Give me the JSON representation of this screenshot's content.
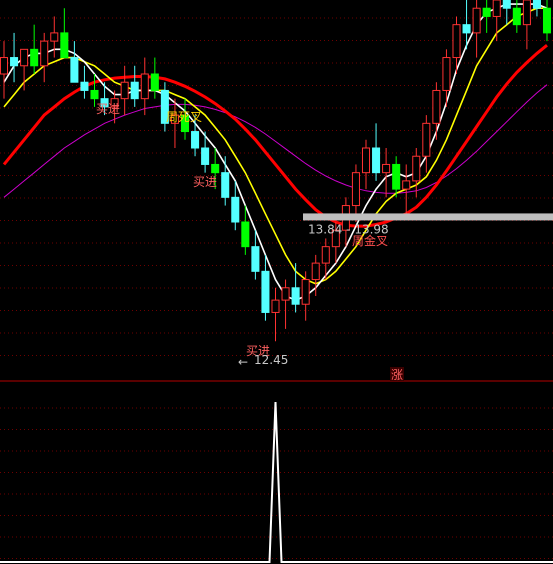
{
  "chart_data": {
    "type": "candlestick",
    "price_ylim": [
      12.1,
      16.6
    ],
    "indicator_ylim": [
      0,
      1
    ],
    "grid": "dotted-horizontal",
    "colors": {
      "up": "#ff3232",
      "down": "#54ffff",
      "down_solid": "#00ff00",
      "ma_fast": "#ffffff",
      "ma_mid": "#ffff00",
      "ma_slow": "#ff0000",
      "ma_long": "#cc00cc",
      "separator": "#b40000",
      "band": "#bebebe"
    },
    "candles": [
      [
        15.7,
        16.1,
        15.4,
        15.9
      ],
      [
        15.9,
        16.2,
        15.6,
        15.8
      ],
      [
        15.8,
        16.0,
        15.5,
        16.0
      ],
      [
        16.0,
        16.3,
        15.7,
        15.8
      ],
      [
        15.8,
        16.2,
        15.6,
        16.1
      ],
      [
        16.1,
        16.4,
        15.9,
        16.2
      ],
      [
        16.2,
        16.5,
        15.9,
        15.9
      ],
      [
        15.9,
        16.1,
        15.6,
        15.6
      ],
      [
        15.6,
        15.8,
        15.4,
        15.5
      ],
      [
        15.5,
        15.7,
        15.3,
        15.4
      ],
      [
        15.4,
        15.6,
        15.2,
        15.3
      ],
      [
        15.3,
        15.5,
        15.1,
        15.4
      ],
      [
        15.4,
        15.8,
        15.2,
        15.6
      ],
      [
        15.6,
        15.8,
        15.3,
        15.4
      ],
      [
        15.4,
        15.9,
        15.2,
        15.7
      ],
      [
        15.7,
        15.9,
        15.4,
        15.5
      ],
      [
        15.5,
        15.6,
        15.0,
        15.1
      ],
      [
        15.1,
        15.4,
        14.8,
        15.2
      ],
      [
        15.2,
        15.4,
        14.9,
        15.0
      ],
      [
        15.0,
        15.2,
        14.7,
        14.8
      ],
      [
        14.8,
        15.0,
        14.5,
        14.6
      ],
      [
        14.6,
        14.8,
        14.3,
        14.5
      ],
      [
        14.5,
        14.7,
        14.1,
        14.2
      ],
      [
        14.2,
        14.4,
        13.8,
        13.9
      ],
      [
        13.9,
        14.1,
        13.5,
        13.6
      ],
      [
        13.6,
        13.8,
        13.2,
        13.3
      ],
      [
        13.3,
        13.5,
        12.7,
        12.8
      ],
      [
        12.8,
        13.1,
        12.45,
        12.95
      ],
      [
        12.95,
        13.2,
        12.6,
        13.1
      ],
      [
        13.1,
        13.4,
        12.8,
        12.9
      ],
      [
        12.9,
        13.3,
        12.7,
        13.2
      ],
      [
        13.2,
        13.5,
        13.0,
        13.4
      ],
      [
        13.4,
        13.7,
        13.2,
        13.6
      ],
      [
        13.6,
        13.9,
        13.4,
        13.8
      ],
      [
        13.8,
        14.2,
        13.6,
        14.1
      ],
      [
        14.1,
        14.6,
        13.9,
        14.5
      ],
      [
        14.5,
        14.9,
        14.3,
        14.8
      ],
      [
        14.8,
        15.1,
        14.4,
        14.5
      ],
      [
        14.5,
        14.8,
        14.2,
        14.6
      ],
      [
        14.6,
        14.7,
        14.2,
        14.3
      ],
      [
        14.3,
        14.6,
        14.0,
        14.4
      ],
      [
        14.4,
        14.8,
        14.2,
        14.7
      ],
      [
        14.7,
        15.2,
        14.5,
        15.1
      ],
      [
        15.1,
        15.6,
        14.9,
        15.5
      ],
      [
        15.5,
        16.0,
        15.3,
        15.9
      ],
      [
        15.9,
        16.4,
        15.7,
        16.3
      ],
      [
        16.3,
        16.7,
        16.0,
        16.2
      ],
      [
        16.2,
        16.6,
        15.9,
        16.5
      ],
      [
        16.5,
        16.8,
        16.2,
        16.4
      ],
      [
        16.4,
        16.7,
        16.1,
        16.6
      ],
      [
        16.6,
        16.9,
        16.3,
        16.5
      ],
      [
        16.5,
        16.8,
        16.2,
        16.3
      ],
      [
        16.3,
        16.7,
        16.0,
        16.6
      ],
      [
        16.6,
        16.9,
        16.4,
        16.5
      ],
      [
        16.5,
        16.7,
        16.1,
        16.2
      ]
    ],
    "ma_fast": [
      15.6,
      15.8,
      15.9,
      15.95,
      15.95,
      16.0,
      16.0,
      15.95,
      15.85,
      15.7,
      15.55,
      15.45,
      15.45,
      15.5,
      15.5,
      15.5,
      15.45,
      15.35,
      15.25,
      15.1,
      14.95,
      14.8,
      14.6,
      14.4,
      14.1,
      13.8,
      13.5,
      13.2,
      13.0,
      12.95,
      13.0,
      13.1,
      13.25,
      13.4,
      13.6,
      13.85,
      14.1,
      14.3,
      14.45,
      14.5,
      14.45,
      14.5,
      14.7,
      15.0,
      15.35,
      15.75,
      16.05,
      16.3,
      16.45,
      16.5,
      16.55,
      16.55,
      16.55,
      16.55,
      16.5
    ],
    "ma_mid": [
      15.3,
      15.45,
      15.6,
      15.7,
      15.8,
      15.85,
      15.9,
      15.9,
      15.85,
      15.8,
      15.7,
      15.6,
      15.55,
      15.5,
      15.5,
      15.5,
      15.5,
      15.45,
      15.4,
      15.3,
      15.2,
      15.05,
      14.9,
      14.7,
      14.5,
      14.25,
      14.0,
      13.75,
      13.5,
      13.3,
      13.2,
      13.15,
      13.2,
      13.3,
      13.45,
      13.6,
      13.8,
      14.0,
      14.15,
      14.25,
      14.3,
      14.35,
      14.45,
      14.65,
      14.9,
      15.2,
      15.5,
      15.8,
      16.0,
      16.2,
      16.3,
      16.4,
      16.45,
      16.5,
      16.5
    ],
    "ma_slow": [
      14.6,
      14.75,
      14.9,
      15.05,
      15.2,
      15.3,
      15.4,
      15.48,
      15.55,
      15.6,
      15.63,
      15.65,
      15.66,
      15.67,
      15.67,
      15.66,
      15.64,
      15.6,
      15.55,
      15.49,
      15.42,
      15.34,
      15.25,
      15.15,
      15.03,
      14.9,
      14.75,
      14.6,
      14.45,
      14.3,
      14.17,
      14.05,
      13.96,
      13.9,
      13.86,
      13.85,
      13.85,
      13.87,
      13.9,
      13.95,
      14.0,
      14.08,
      14.2,
      14.35,
      14.52,
      14.7,
      14.88,
      15.06,
      15.24,
      15.42,
      15.58,
      15.72,
      15.84,
      15.95,
      16.05
    ],
    "ma_long": [
      14.2,
      14.3,
      14.4,
      14.5,
      14.6,
      14.7,
      14.8,
      14.88,
      14.96,
      15.03,
      15.1,
      15.15,
      15.2,
      15.24,
      15.28,
      15.3,
      15.32,
      15.33,
      15.33,
      15.32,
      15.3,
      15.27,
      15.23,
      15.18,
      15.12,
      15.05,
      14.97,
      14.88,
      14.79,
      14.7,
      14.61,
      14.53,
      14.46,
      14.4,
      14.35,
      14.31,
      14.28,
      14.26,
      14.25,
      14.25,
      14.26,
      14.28,
      14.32,
      14.38,
      14.46,
      14.55,
      14.65,
      14.76,
      14.88,
      15.0,
      15.12,
      15.24,
      15.36,
      15.47,
      15.57
    ],
    "signal_spike_index": 27,
    "price_band": {
      "low": 13.84,
      "high": 13.98,
      "label": "13.84 - 13.98"
    },
    "low_marker": {
      "value": 12.45,
      "label": "12.45"
    },
    "annotations": {
      "buy_1": "买进",
      "death_cross": "周死叉",
      "buy_2": "买进",
      "buy_3": "买进",
      "golden_cross": "周金叉",
      "rise_badge": "涨"
    }
  }
}
